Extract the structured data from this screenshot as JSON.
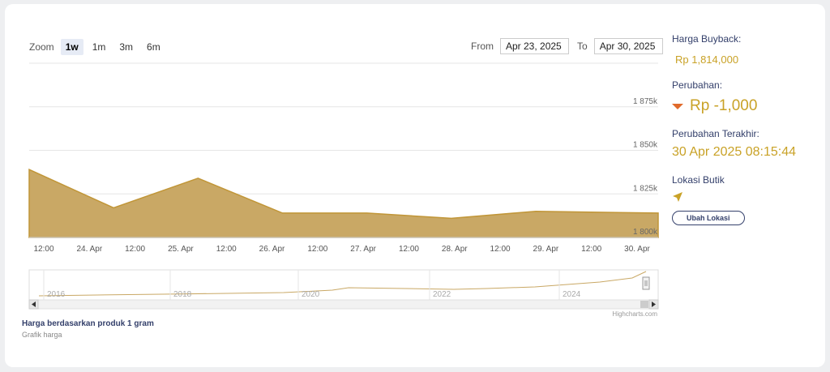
{
  "zoom": {
    "label": "Zoom",
    "buttons": [
      "1w",
      "1m",
      "3m",
      "6m"
    ],
    "active": "1w"
  },
  "range": {
    "from_label": "From",
    "from_value": "Apr 23, 2025",
    "to_label": "To",
    "to_value": "Apr 30, 2025"
  },
  "side": {
    "buyback_label": "Harga Buyback:",
    "buyback_value": "Rp 1,814,000",
    "change_label": "Perubahan:",
    "change_value": "Rp -1,000",
    "last_change_label": "Perubahan Terakhir:",
    "last_change_value": "30 Apr 2025 08:15:44",
    "location_label": "Lokasi Butik",
    "location_button": "Ubah Lokasi"
  },
  "caption": {
    "title": "Harga berdasarkan produk 1 gram",
    "subtitle": "Grafik harga"
  },
  "credits": "Highcharts.com",
  "colors": {
    "area_fill": "#c9a865",
    "area_line": "#c19638",
    "gold_text": "#c9a227",
    "navy": "#34406b",
    "down_arrow": "#e06a2b"
  },
  "chart_data": {
    "type": "area",
    "x": [
      "2025-04-23 12:00",
      "2025-04-24 12:00",
      "2025-04-25 12:00",
      "2025-04-26 12:00",
      "2025-04-27 12:00",
      "2025-04-28 12:00",
      "2025-04-29 12:00",
      "2025-04-30 12:00"
    ],
    "values": [
      1839000,
      1817000,
      1834000,
      1814000,
      1814000,
      1811000,
      1815000,
      1814000
    ],
    "ylim": [
      1800000,
      1900000
    ],
    "yticks": [
      1800000,
      1825000,
      1850000,
      1875000
    ],
    "ytick_labels": [
      "1 800k",
      "1 825k",
      "1 850k",
      "1 875k"
    ],
    "xtick_labels": [
      "12:00",
      "24. Apr",
      "12:00",
      "25. Apr",
      "12:00",
      "26. Apr",
      "12:00",
      "27. Apr",
      "12:00",
      "28. Apr",
      "12:00",
      "29. Apr",
      "12:00",
      "30. Apr"
    ],
    "navigator_labels": [
      "2016",
      "2018",
      "2020",
      "2022",
      "2024"
    ],
    "grid": true,
    "legend": "none"
  }
}
